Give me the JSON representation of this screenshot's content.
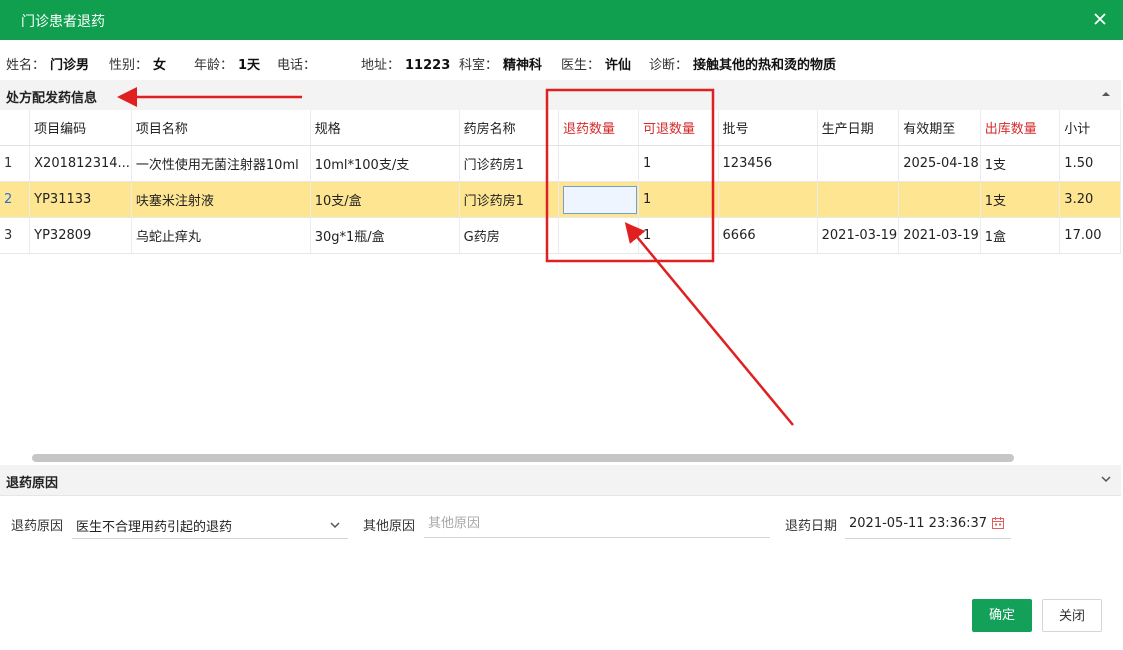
{
  "window": {
    "title": "门诊患者退药"
  },
  "patient": {
    "name_label": "姓名：",
    "name": "门诊男",
    "gender_label": "性别：",
    "gender": "女",
    "age_label": "年龄：",
    "age": "1天",
    "phone_label": "电话：",
    "phone": "",
    "address_label": "地址：",
    "address": "11223",
    "dept_label": "科室：",
    "dept": "精神科",
    "doctor_label": "医生：",
    "doctor": "许仙",
    "diagnosis_label": "诊断：",
    "diagnosis": "接触其他的热和烫的物质"
  },
  "prescription": {
    "section_title": "处方配发药信息",
    "columns": [
      "项目编码",
      "项目名称",
      "规格",
      "药房名称",
      "退药数量",
      "可退数量",
      "批号",
      "生产日期",
      "有效期至",
      "出库数量",
      "小计"
    ],
    "rows": [
      {
        "no": "1",
        "code": "X201812314...",
        "name": "一次性使用无菌注射器10ml",
        "spec": "10ml*100支/支",
        "pharmacy": "门诊药房1",
        "return_qty": "",
        "avail_qty": "1",
        "batch": "123456",
        "mfg_date": "",
        "expiry": "2025-04-18",
        "out_qty": "1支",
        "subtotal": "1.50"
      },
      {
        "no": "2",
        "code": "YP31133",
        "name": "呋塞米注射液",
        "spec": "10支/盒",
        "pharmacy": "门诊药房1",
        "return_qty": "",
        "avail_qty": "1",
        "batch": "",
        "mfg_date": "",
        "expiry": "",
        "out_qty": "1支",
        "subtotal": "3.20"
      },
      {
        "no": "3",
        "code": "YP32809",
        "name": "乌蛇止痒丸",
        "spec": "30g*1瓶/盒",
        "pharmacy": "G药房",
        "return_qty": "",
        "avail_qty": "1",
        "batch": "6666",
        "mfg_date": "2021-03-19",
        "expiry": "2021-03-19",
        "out_qty": "1盒",
        "subtotal": "17.00"
      }
    ]
  },
  "reason_section": {
    "section_title": "退药原因",
    "reason_label": "退药原因",
    "reason_value": "医生不合理用药引起的退药",
    "other_label": "其他原因",
    "other_placeholder": "其他原因",
    "date_label": "退药日期",
    "date_value": "2021-05-11 23:36:37"
  },
  "buttons": {
    "ok": "确定",
    "close": "关闭"
  },
  "colors": {
    "titlebar": "#0f9f4f",
    "selected_row": "#fde592",
    "required_header": "#d42b2b",
    "annotation": "#e02020"
  }
}
